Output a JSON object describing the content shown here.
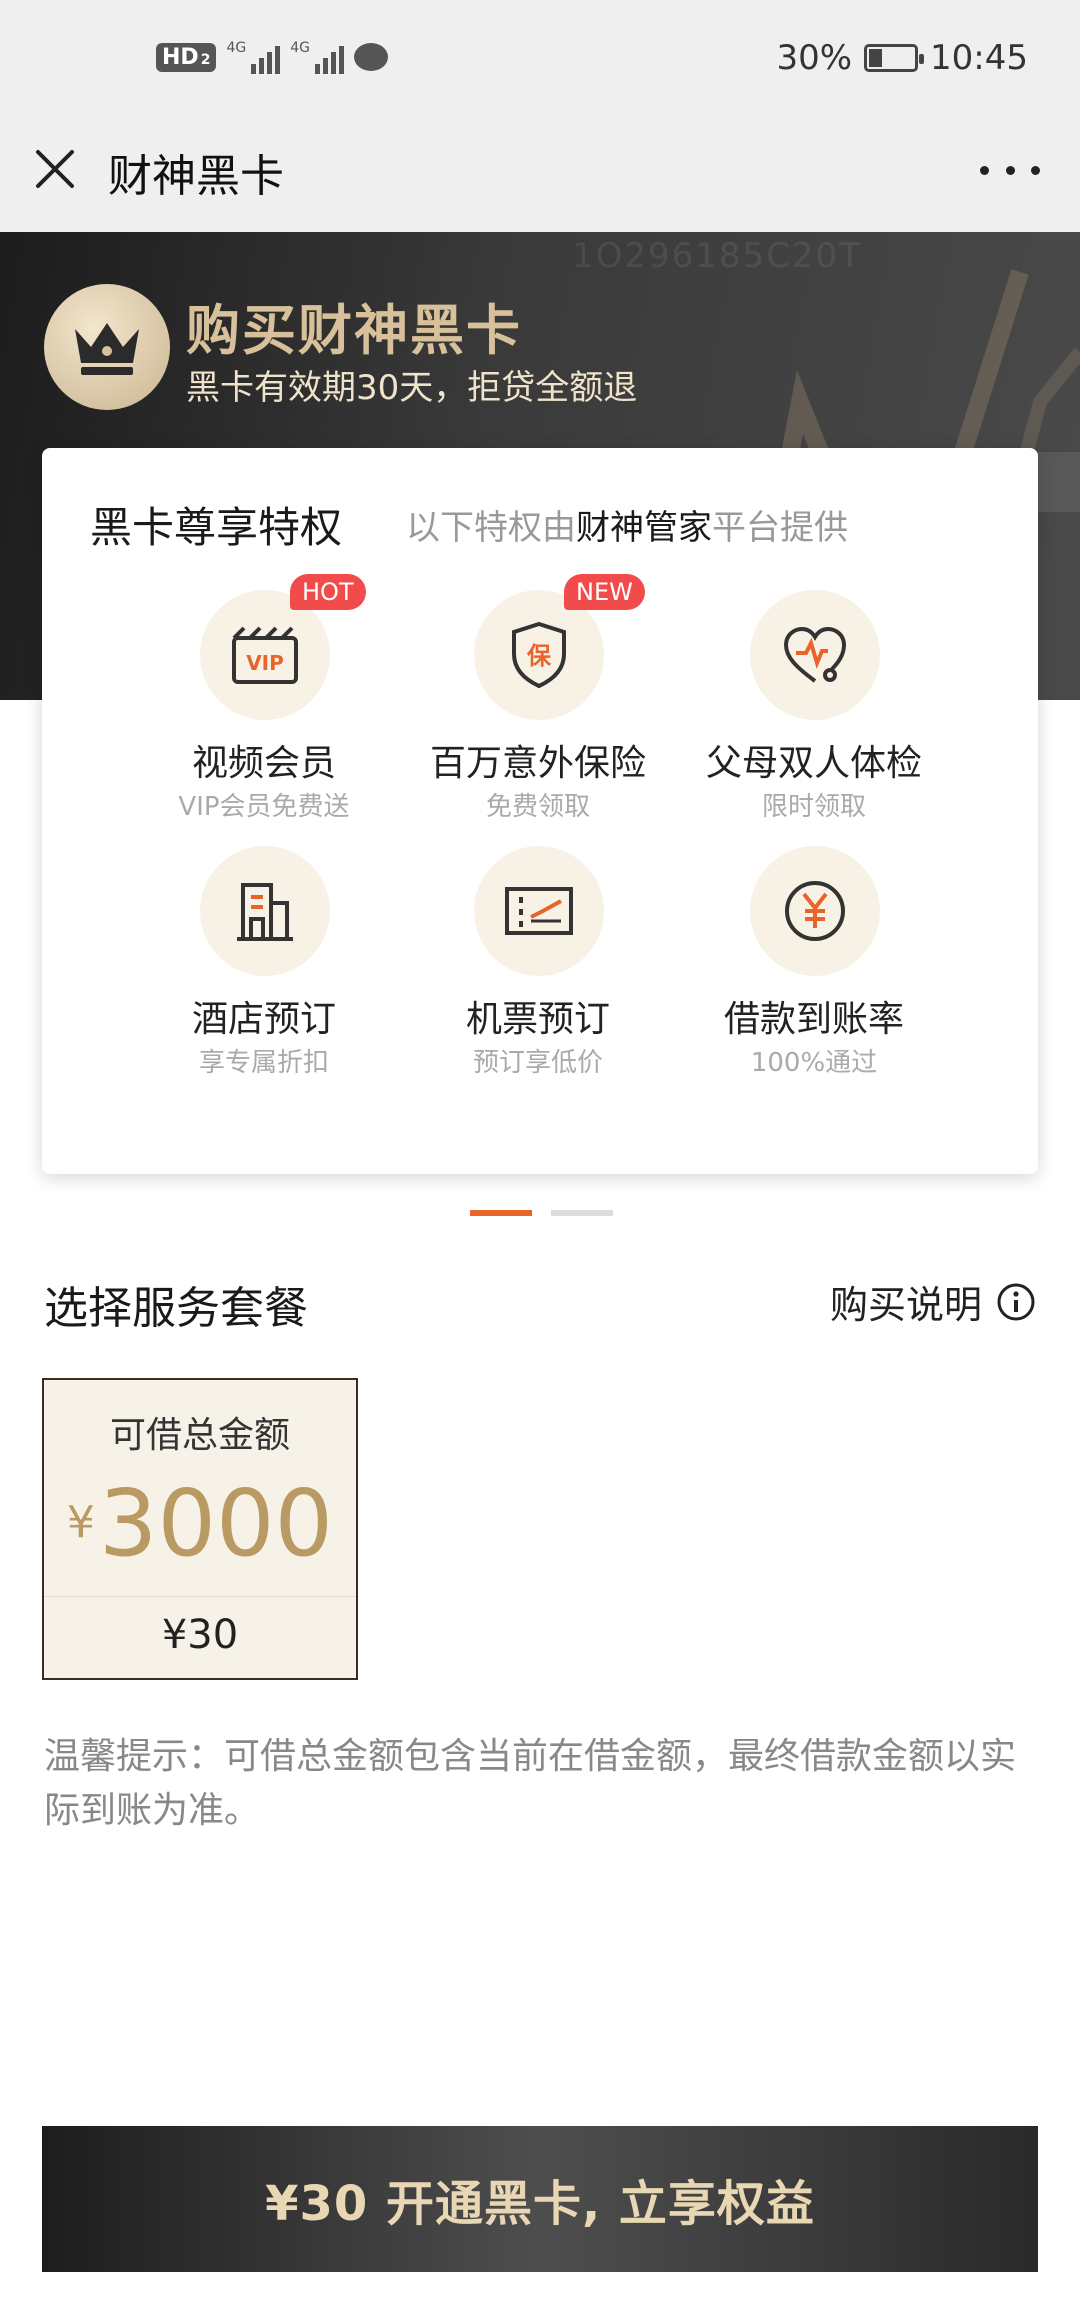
{
  "status_bar": {
    "hd_label": "HD",
    "hd_sub": "2",
    "net1": "4G",
    "net2": "4G",
    "battery_percent": "30%",
    "time": "10:45",
    "battery_level": 0.3
  },
  "nav": {
    "title": "财神黑卡",
    "close_icon": "close-icon",
    "more_icon": "more-icon"
  },
  "banner": {
    "watermark": "1O296185C20T",
    "title": "购买财神黑卡",
    "subtitle": "黑卡有效期30天，拒贷全额退"
  },
  "privileges": {
    "title": "黑卡尊享特权",
    "subtitle_prefix": "以下特权由",
    "subtitle_highlight": "财神管家",
    "subtitle_suffix": "平台提供",
    "items": [
      {
        "name": "视频会员",
        "desc": "VIP会员免费送",
        "badge": "HOT",
        "icon": "vip-icon"
      },
      {
        "name": "百万意外保险",
        "desc": "免费领取",
        "badge": "NEW",
        "icon": "insurance-shield-icon"
      },
      {
        "name": "父母双人体检",
        "desc": "限时领取",
        "badge": "",
        "icon": "heart-stethoscope-icon"
      },
      {
        "name": "酒店预订",
        "desc": "享专属折扣",
        "badge": "",
        "icon": "hotel-icon"
      },
      {
        "name": "机票预订",
        "desc": "预订享低价",
        "badge": "",
        "icon": "ticket-icon"
      },
      {
        "name": "借款到账率",
        "desc": "100%通过",
        "badge": "",
        "icon": "yen-coin-icon"
      }
    ]
  },
  "pager": {
    "active_index": 0,
    "count": 2
  },
  "service": {
    "title": "选择服务套餐",
    "buy_note": "购买说明",
    "package": {
      "label": "可借总金额",
      "currency": "¥",
      "amount": "3000",
      "price": "¥30"
    },
    "tip": "温馨提示：可借总金额包含当前在借金额，最终借款金额以实际到账为准。"
  },
  "cta": {
    "label": "¥30 开通黑卡, 立享权益"
  },
  "colors": {
    "accent": "#e8642a",
    "gold": "#b99a62",
    "badge_red": "#f24b4b",
    "banner_dark": "#2a2a2a"
  }
}
